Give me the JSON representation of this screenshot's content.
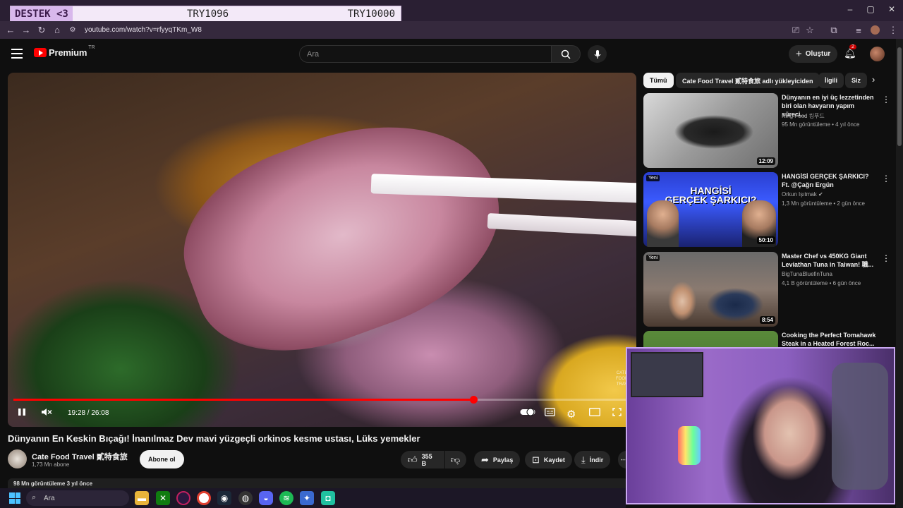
{
  "browser": {
    "url": "youtube.com/watch?v=rfyyqTKm_W8"
  },
  "donation": {
    "label": "DESTEK <3",
    "value1": "TRY1096",
    "value2": "TRY10000"
  },
  "header": {
    "logo": "Premium",
    "region": "TR",
    "search_placeholder": "Ara",
    "create_label": "Oluştur",
    "notif_count": "2"
  },
  "player": {
    "time": "19:28 / 26:08",
    "progress_fraction": 0.745,
    "watermark": "CATE\nFOOD\nTRAV"
  },
  "video": {
    "title": "Dünyanın En Keskin Bıçağı!  İnanılmaz Dev mavi yüzgeçli orkinos kesme ustası, Lüks yemekler",
    "channel": "Cate Food Travel 貳特食旅",
    "subscribers": "1,73 Mn abone",
    "subscribe_label": "Abone ol",
    "likes": "355 B",
    "share_label": "Paylaş",
    "save_label": "Kaydet",
    "download_label": "İndir",
    "views_line": "98 Mn görüntüleme  3 yıl önce"
  },
  "chips": [
    "Tümü",
    "Cate Food Travel 貳特食旅 adlı yükleyiciden",
    "İlgili",
    "Siz"
  ],
  "recommendations": [
    {
      "title": "Dünyanın en iyi üç lezzetinden biri olan havyarın yapım süreci...",
      "channel": "King Food 킹푸드",
      "meta": "95 Mn görüntüleme • 4 yıl önce",
      "duration": "12:09",
      "new": ""
    },
    {
      "title": "HANGİSİ GERÇEK ŞARKICI? Ft. @Çağrı Ergün",
      "channel": "Orkun Işıtmak ✔",
      "meta": "1,3 Mn görüntüleme • 2 gün önce",
      "duration": "50:10",
      "new": "Yeni",
      "thumb_text": "HANGİSİ\nGERÇEK ŞARKICI?"
    },
    {
      "title": "Master Chef vs 450KG Giant Leviathan Tuna in Taiwan! 職...",
      "channel": "BigTunaBluefinTuna",
      "meta": "4,1 B görüntüleme • 6 gün önce",
      "duration": "8:54",
      "new": "Yeni"
    },
    {
      "title": "Cooking the Perfect Tomahawk Steak in a Heated Forest Roc...",
      "channel": "",
      "meta": "",
      "duration": "",
      "new": ""
    }
  ],
  "taskbar": {
    "search_placeholder": "Ara"
  }
}
